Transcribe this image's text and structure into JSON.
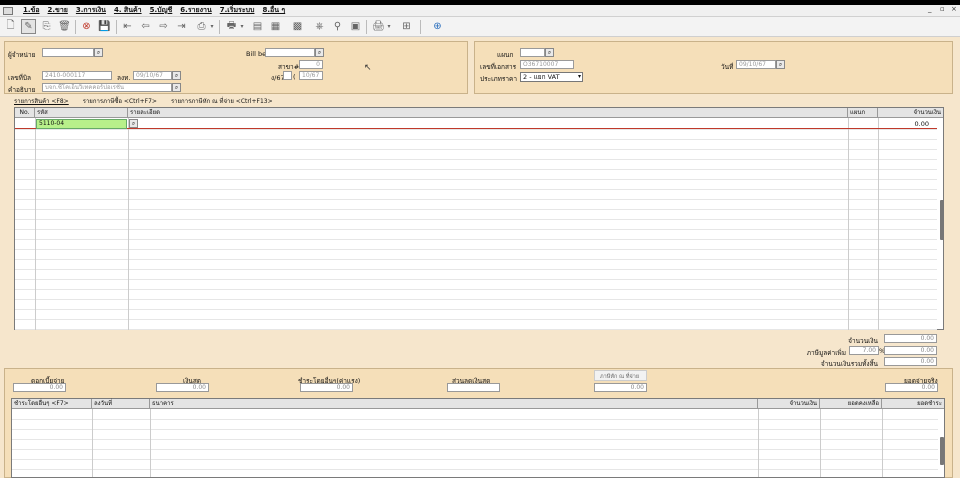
{
  "menu": {
    "items": [
      "1.ข้อ",
      "2.ขาย",
      "3.การเงิน",
      "4. สินค้า",
      "5.บัญชี",
      "6.รายงาน",
      "7.เริ่มระบบ",
      "8.อื่น ๆ"
    ],
    "win_controls": [
      "_",
      "▫",
      "×"
    ]
  },
  "header_left": {
    "supplier_label": "ผู้จำหน่าย",
    "supplier_value": "",
    "doc_no_label": "เลขที่บิล",
    "doc_no_value": "2410-000117",
    "date_label": "ลงท.",
    "date_value": "09/10/67",
    "desc_label": "คำอธิบาย",
    "desc_value": "บจก.ซีโคเอ็นวิเทคคอร์ปอเรชั่น",
    "billbe_label": "Bill be",
    "billbe_value": "",
    "branch_label": "สาขา#",
    "branch_value": "0",
    "period_label": "ง/67",
    "period_prefix": "(",
    "period_value": "10/67"
  },
  "header_right": {
    "dept_label": "แผนก",
    "dept_value": "",
    "ref_label": "เลขที่เอกสาร",
    "ref_value": "O36710007",
    "price_type_label": "ประเภทราคา",
    "price_type_value": "2 - แยก VAT",
    "date_label": "วันที่",
    "date_value": "09/10/67"
  },
  "tabs": [
    "รายการสินค้า <F8>",
    "รายการภาษีซื้อ <Ctrl+F7>",
    "รายการภาษีหัก ณ ที่จ่าย <Ctrl+F13>"
  ],
  "grid": {
    "columns": [
      "No.",
      "รหัส",
      "รายละเอียด",
      "แผนก",
      "จำนวนเงิน"
    ],
    "rows": [
      {
        "no": "",
        "code": "5110-04",
        "detail": "",
        "dept": "",
        "amount": "0.00"
      }
    ]
  },
  "totals": {
    "amount_label": "จำนวนเงิน",
    "amount_value": "0.00",
    "vat_label": "ภาษีมูลค่าเพิ่ม",
    "vat_rate": "7.00",
    "vat_pct": "%",
    "vat_value": "0.00",
    "net_label": "จำนวนเงินรวมทั้งสิ้น",
    "net_value": "0.00"
  },
  "payment": {
    "cash_label": "ดอกเบี้ยจ่าย",
    "cash_value": "0.00",
    "transfer_label": "เงินสด",
    "transfer_value": "0.00",
    "other_label": "ชำระโดยอื่นๆ(ค่าแรง)",
    "other_value": "0.00",
    "discount_label": "ส่วนลดเงินสด",
    "discount_value": "",
    "wht_label": "ภาษีหัก ณ ที่จ่าย",
    "wht_value": "0.00",
    "total_label": "ยอดจ่ายจริง",
    "total_value": "0.00"
  },
  "pay_grid": {
    "columns": [
      "ชำระโดยอื่นๆ <F7>",
      "ลงวันที่",
      "ธนาคาร",
      "จำนวนเงิน",
      "ยอดคงเหลือ",
      "ยอดชำระ"
    ]
  }
}
